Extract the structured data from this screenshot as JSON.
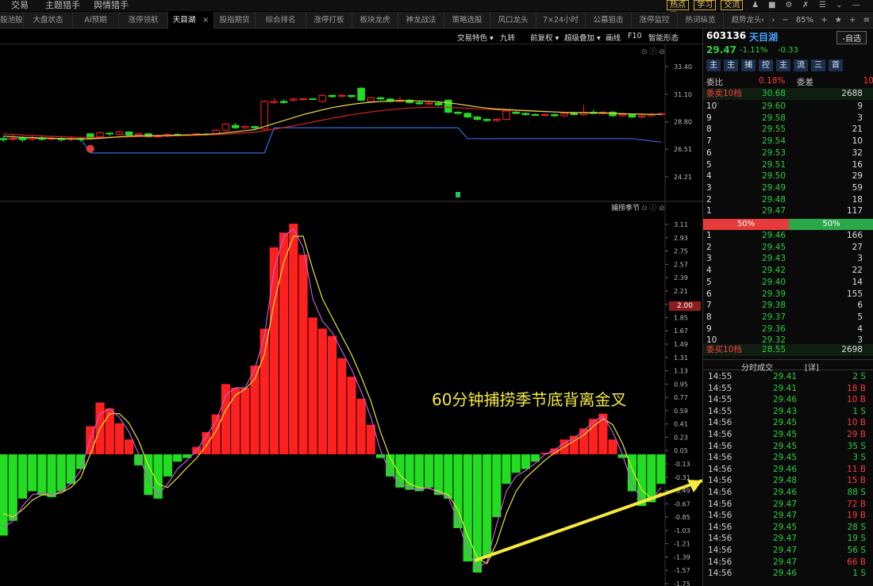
{
  "topbar": {
    "menu": [
      "交易",
      "主题猎手",
      "舆情猎手"
    ],
    "buttons": [
      "热点",
      "学习",
      "交流"
    ]
  },
  "tabs": {
    "items": [
      "股池股",
      "大盘状态",
      "AI预期",
      "涨停领航",
      "天目湖",
      "股指期货",
      "综合排名",
      "涨停打板",
      "板块龙虎",
      "神龙战法",
      "策略选股",
      "风口龙头",
      "7×24小时",
      "公募狙击",
      "涨停监控",
      "热词纵览",
      "趋势龙头"
    ],
    "active_index": 4,
    "close_glyph": "×",
    "zoom": "85%"
  },
  "toolbar": {
    "items": [
      "交易特色 ▾",
      "九转",
      "前复权 ▾",
      "超级叠加 ▾",
      "画线",
      "F10",
      "智能形态"
    ]
  },
  "price_axis": {
    "ticks": [
      "33.40",
      "31.10",
      "28.80",
      "26.51",
      "24.21"
    ]
  },
  "indicator": {
    "name": "捕捞季节",
    "marker_value": "2.00",
    "ticks": [
      "3.11",
      "2.93",
      "2.75",
      "2.57",
      "2.39",
      "2.21",
      "2.03",
      "1.85",
      "1.67",
      "1.49",
      "1.31",
      "1.13",
      "0.95",
      "0.77",
      "0.59",
      "0.41",
      "0.23",
      "0.05",
      "-0.13",
      "-0.31",
      "-0.49",
      "-0.67",
      "-0.85",
      "-1.03",
      "-1.21",
      "-1.39",
      "-1.57",
      "-1.75"
    ]
  },
  "annotation": "60分钟捕捞季节底背离金叉",
  "colors": {
    "up": "#ff2020",
    "down": "#22dd22",
    "annotation": "#f6ea3b"
  },
  "quote": {
    "code": "603136",
    "name": "天目湖",
    "self_select": "-自选",
    "price": "29.47",
    "change_pct": "-1.11%",
    "change": "-0.33",
    "quick_buttons": [
      "主",
      "主",
      "捕",
      "控",
      "主",
      "流",
      "三",
      "首"
    ],
    "ratio_label": "委比",
    "ratio_value": "0.18%",
    "diff_label": "委差",
    "diff_value": "10",
    "sell10_label": "委卖10档",
    "sell10_price": "30.68",
    "sell10_vol": "2688",
    "asks": [
      {
        "lvl": "10",
        "price": "29.60",
        "vol": "9"
      },
      {
        "lvl": "9",
        "price": "29.58",
        "vol": "3"
      },
      {
        "lvl": "8",
        "price": "29.55",
        "vol": "21"
      },
      {
        "lvl": "7",
        "price": "29.54",
        "vol": "10"
      },
      {
        "lvl": "6",
        "price": "29.53",
        "vol": "32"
      },
      {
        "lvl": "5",
        "price": "29.51",
        "vol": "16"
      },
      {
        "lvl": "4",
        "price": "29.50",
        "vol": "29"
      },
      {
        "lvl": "3",
        "price": "29.49",
        "vol": "59"
      },
      {
        "lvl": "2",
        "price": "29.48",
        "vol": "18"
      },
      {
        "lvl": "1",
        "price": "29.47",
        "vol": "117"
      }
    ],
    "split_left": "50%",
    "split_right": "50%",
    "bids": [
      {
        "lvl": "1",
        "price": "29.46",
        "vol": "166"
      },
      {
        "lvl": "2",
        "price": "29.45",
        "vol": "27"
      },
      {
        "lvl": "3",
        "price": "29.43",
        "vol": "3"
      },
      {
        "lvl": "4",
        "price": "29.42",
        "vol": "22"
      },
      {
        "lvl": "5",
        "price": "29.40",
        "vol": "14"
      },
      {
        "lvl": "6",
        "price": "29.39",
        "vol": "155"
      },
      {
        "lvl": "7",
        "price": "29.38",
        "vol": "6"
      },
      {
        "lvl": "8",
        "price": "29.37",
        "vol": "5"
      },
      {
        "lvl": "9",
        "price": "29.36",
        "vol": "4"
      },
      {
        "lvl": "10",
        "price": "29.32",
        "vol": "3"
      }
    ],
    "buy10_label": "委买10档",
    "buy10_price": "28.55",
    "buy10_vol": "2698",
    "trades_title": "分时成交",
    "trades_detail": "[详]",
    "trades": [
      {
        "t": "14:55",
        "p": "29.41",
        "v": "2 S",
        "side": "S"
      },
      {
        "t": "14:55",
        "p": "29.41",
        "v": "18 B",
        "side": "B"
      },
      {
        "t": "14:55",
        "p": "29.46",
        "v": "10 B",
        "side": "B"
      },
      {
        "t": "14:55",
        "p": "29.43",
        "v": "1 S",
        "side": "S"
      },
      {
        "t": "14:56",
        "p": "29.45",
        "v": "10 B",
        "side": "B"
      },
      {
        "t": "14:56",
        "p": "29.45",
        "v": "29 B",
        "side": "B"
      },
      {
        "t": "14:56",
        "p": "29.45",
        "v": "35 S",
        "side": "S"
      },
      {
        "t": "14:56",
        "p": "29.45",
        "v": "3 S",
        "side": "S"
      },
      {
        "t": "14:56",
        "p": "29.46",
        "v": "11 B",
        "side": "B"
      },
      {
        "t": "14:56",
        "p": "29.48",
        "v": "15 B",
        "side": "B"
      },
      {
        "t": "14:56",
        "p": "29.46",
        "v": "88 S",
        "side": "S"
      },
      {
        "t": "14:56",
        "p": "29.47",
        "v": "72 B",
        "side": "B"
      },
      {
        "t": "14:56",
        "p": "29.47",
        "v": "19 B",
        "side": "B"
      },
      {
        "t": "14:56",
        "p": "29.45",
        "v": "28 S",
        "side": "S"
      },
      {
        "t": "14:56",
        "p": "29.47",
        "v": "19 S",
        "side": "S"
      },
      {
        "t": "14:56",
        "p": "29.47",
        "v": "56 S",
        "side": "S"
      },
      {
        "t": "14:56",
        "p": "29.47",
        "v": "66 B",
        "side": "B"
      },
      {
        "t": "14:56",
        "p": "29.46",
        "v": "1 S",
        "side": "S"
      }
    ]
  },
  "candles": [
    {
      "o": 27.4,
      "c": 27.3,
      "h": 27.6,
      "l": 27.1
    },
    {
      "o": 27.35,
      "c": 27.4,
      "h": 27.7,
      "l": 27.2
    },
    {
      "o": 27.45,
      "c": 27.3,
      "h": 27.6,
      "l": 27.1
    },
    {
      "o": 27.35,
      "c": 27.45,
      "h": 27.7,
      "l": 27.2
    },
    {
      "o": 27.4,
      "c": 27.35,
      "h": 27.6,
      "l": 27.2
    },
    {
      "o": 27.4,
      "c": 27.42,
      "h": 27.6,
      "l": 27.2
    },
    {
      "o": 27.4,
      "c": 27.3,
      "h": 27.55,
      "l": 27.1
    },
    {
      "o": 27.35,
      "c": 27.4,
      "h": 27.6,
      "l": 27.2
    },
    {
      "o": 27.4,
      "c": 27.32,
      "h": 27.55,
      "l": 27.15
    },
    {
      "o": 27.8,
      "c": 27.4,
      "h": 27.85,
      "l": 27.3
    },
    {
      "o": 27.55,
      "c": 27.9,
      "h": 28.0,
      "l": 27.5
    },
    {
      "o": 27.85,
      "c": 27.8,
      "h": 27.95,
      "l": 27.6
    },
    {
      "o": 27.75,
      "c": 27.95,
      "h": 28.05,
      "l": 27.7
    },
    {
      "o": 27.95,
      "c": 27.7,
      "h": 28.0,
      "l": 27.6
    },
    {
      "o": 27.7,
      "c": 27.8,
      "h": 27.9,
      "l": 27.55
    },
    {
      "o": 27.8,
      "c": 27.55,
      "h": 27.85,
      "l": 27.45
    },
    {
      "o": 27.55,
      "c": 27.6,
      "h": 27.75,
      "l": 27.45
    },
    {
      "o": 27.6,
      "c": 27.75,
      "h": 27.85,
      "l": 27.5
    },
    {
      "o": 27.75,
      "c": 27.7,
      "h": 27.85,
      "l": 27.6
    },
    {
      "o": 27.7,
      "c": 27.72,
      "h": 27.8,
      "l": 27.6
    },
    {
      "o": 27.7,
      "c": 27.8,
      "h": 27.85,
      "l": 27.6
    },
    {
      "o": 27.78,
      "c": 27.74,
      "h": 27.85,
      "l": 27.65
    },
    {
      "o": 27.75,
      "c": 28.1,
      "h": 28.2,
      "l": 27.7
    },
    {
      "o": 28.1,
      "c": 28.6,
      "h": 28.7,
      "l": 28.0
    },
    {
      "o": 28.5,
      "c": 28.3,
      "h": 28.7,
      "l": 28.2
    },
    {
      "o": 28.3,
      "c": 28.4,
      "h": 28.5,
      "l": 28.2
    },
    {
      "o": 28.4,
      "c": 28.3,
      "h": 28.5,
      "l": 28.2
    },
    {
      "o": 28.2,
      "c": 30.5,
      "h": 30.6,
      "l": 28.1
    },
    {
      "o": 30.4,
      "c": 30.5,
      "h": 30.8,
      "l": 30.3
    },
    {
      "o": 30.5,
      "c": 30.4,
      "h": 30.7,
      "l": 30.3
    },
    {
      "o": 30.6,
      "c": 30.7,
      "h": 30.8,
      "l": 30.5
    },
    {
      "o": 30.7,
      "c": 30.72,
      "h": 30.75,
      "l": 30.65
    },
    {
      "o": 30.72,
      "c": 30.7,
      "h": 30.76,
      "l": 30.65
    },
    {
      "o": 30.5,
      "c": 31.0,
      "h": 31.1,
      "l": 30.4
    },
    {
      "o": 31.0,
      "c": 30.9,
      "h": 31.05,
      "l": 30.8
    },
    {
      "o": 30.95,
      "c": 31.0,
      "h": 31.1,
      "l": 30.85
    },
    {
      "o": 31.0,
      "c": 30.9,
      "h": 31.05,
      "l": 30.8
    },
    {
      "o": 31.6,
      "c": 30.6,
      "h": 31.7,
      "l": 30.5
    },
    {
      "o": 30.5,
      "c": 30.8,
      "h": 30.9,
      "l": 30.4
    },
    {
      "o": 30.8,
      "c": 30.7,
      "h": 30.9,
      "l": 30.6
    },
    {
      "o": 30.7,
      "c": 30.5,
      "h": 30.8,
      "l": 30.4
    },
    {
      "o": 30.5,
      "c": 30.6,
      "h": 30.9,
      "l": 30.45
    },
    {
      "o": 30.6,
      "c": 30.4,
      "h": 30.7,
      "l": 30.3
    },
    {
      "o": 30.4,
      "c": 30.3,
      "h": 30.5,
      "l": 30.2
    },
    {
      "o": 30.3,
      "c": 30.35,
      "h": 30.45,
      "l": 30.2
    },
    {
      "o": 30.35,
      "c": 30.2,
      "h": 30.45,
      "l": 30.1
    },
    {
      "o": 30.6,
      "c": 29.6,
      "h": 30.7,
      "l": 29.5
    },
    {
      "o": 29.6,
      "c": 29.5,
      "h": 29.7,
      "l": 29.4
    },
    {
      "o": 29.5,
      "c": 29.2,
      "h": 29.6,
      "l": 29.1
    },
    {
      "o": 29.2,
      "c": 29.0,
      "h": 29.3,
      "l": 28.9
    },
    {
      "o": 29.0,
      "c": 28.9,
      "h": 29.1,
      "l": 28.8
    },
    {
      "o": 28.9,
      "c": 29.0,
      "h": 29.1,
      "l": 28.8
    },
    {
      "o": 29.0,
      "c": 29.7,
      "h": 29.8,
      "l": 28.9
    },
    {
      "o": 29.6,
      "c": 29.5,
      "h": 29.7,
      "l": 29.4
    },
    {
      "o": 29.5,
      "c": 29.4,
      "h": 29.6,
      "l": 29.3
    },
    {
      "o": 29.4,
      "c": 29.35,
      "h": 29.5,
      "l": 29.3
    },
    {
      "o": 29.35,
      "c": 29.4,
      "h": 29.5,
      "l": 29.3
    },
    {
      "o": 29.4,
      "c": 29.3,
      "h": 29.5,
      "l": 29.2
    },
    {
      "o": 29.3,
      "c": 29.5,
      "h": 29.6,
      "l": 29.2
    },
    {
      "o": 29.5,
      "c": 29.4,
      "h": 29.65,
      "l": 29.3
    },
    {
      "o": 29.4,
      "c": 29.6,
      "h": 30.2,
      "l": 29.3
    },
    {
      "o": 29.6,
      "c": 29.5,
      "h": 29.8,
      "l": 29.4
    },
    {
      "o": 29.5,
      "c": 29.6,
      "h": 29.7,
      "l": 29.4
    },
    {
      "o": 29.6,
      "c": 29.3,
      "h": 29.7,
      "l": 29.2
    },
    {
      "o": 29.3,
      "c": 29.4,
      "h": 29.5,
      "l": 29.2
    },
    {
      "o": 29.4,
      "c": 29.2,
      "h": 29.5,
      "l": 29.1
    },
    {
      "o": 29.2,
      "c": 29.3,
      "h": 29.4,
      "l": 29.1
    },
    {
      "o": 29.3,
      "c": 29.4,
      "h": 29.55,
      "l": 29.2
    },
    {
      "o": 29.4,
      "c": 29.47,
      "h": 29.6,
      "l": 29.3
    }
  ],
  "ma1": [
    27.6,
    27.55,
    27.5,
    27.48,
    27.45,
    27.43,
    27.4,
    27.38,
    27.37,
    27.38,
    27.42,
    27.48,
    27.55,
    27.6,
    27.63,
    27.64,
    27.65,
    27.66,
    27.68,
    27.7,
    27.73,
    27.75,
    27.8,
    27.88,
    27.97,
    28.06,
    28.15,
    28.4,
    28.65,
    28.9,
    29.15,
    29.4,
    29.6,
    29.8,
    29.98,
    30.12,
    30.25,
    30.35,
    30.43,
    30.49,
    30.53,
    30.56,
    30.56,
    30.54,
    30.51,
    30.46,
    30.38,
    30.28,
    30.16,
    30.04,
    29.94,
    29.86,
    29.82,
    29.78,
    29.74,
    29.7,
    29.66,
    29.62,
    29.58,
    29.56,
    29.55,
    29.54,
    29.53,
    29.5,
    29.48,
    29.45,
    29.43,
    29.42,
    29.42
  ],
  "ma2": [
    27.8,
    27.75,
    27.7,
    27.66,
    27.62,
    27.58,
    27.55,
    27.52,
    27.5,
    27.49,
    27.49,
    27.5,
    27.52,
    27.54,
    27.56,
    27.58,
    27.6,
    27.62,
    27.64,
    27.66,
    27.68,
    27.7,
    27.73,
    27.77,
    27.82,
    27.88,
    27.94,
    28.05,
    28.18,
    28.32,
    28.47,
    28.62,
    28.78,
    28.94,
    29.09,
    29.24,
    29.38,
    29.51,
    29.62,
    29.72,
    29.81,
    29.88,
    29.94,
    29.98,
    30.0,
    30.01,
    30.0,
    29.97,
    29.93,
    29.88,
    29.84,
    29.8,
    29.77,
    29.74,
    29.71,
    29.68,
    29.65,
    29.62,
    29.59,
    29.57,
    29.55,
    29.53,
    29.51,
    29.49,
    29.47,
    29.45,
    29.43,
    29.42,
    29.41
  ],
  "support": [
    27.4,
    27.4,
    27.4,
    27.4,
    27.4,
    27.4,
    27.4,
    27.4,
    27.4,
    26.2,
    26.2,
    26.2,
    26.2,
    26.2,
    26.2,
    26.2,
    26.2,
    26.2,
    26.2,
    26.2,
    26.2,
    26.2,
    26.2,
    26.2,
    26.2,
    26.2,
    26.2,
    26.2,
    28.3,
    28.3,
    28.3,
    28.3,
    28.3,
    28.3,
    28.3,
    28.3,
    28.3,
    28.3,
    28.3,
    28.3,
    28.3,
    28.3,
    28.3,
    28.3,
    28.3,
    28.3,
    28.3,
    28.3,
    27.4,
    27.4,
    27.4,
    27.4,
    27.4,
    27.4,
    27.4,
    27.4,
    27.4,
    27.4,
    27.4,
    27.4,
    27.4,
    27.4,
    27.4,
    27.4,
    27.4,
    27.4,
    27.3,
    27.2,
    27.1
  ],
  "hist": [
    -1.1,
    -0.9,
    -0.6,
    -0.5,
    -0.55,
    -0.58,
    -0.5,
    -0.4,
    -0.2,
    0.38,
    0.7,
    0.62,
    0.42,
    0.2,
    -0.15,
    -0.55,
    -0.6,
    -0.3,
    -0.1,
    -0.05,
    0.1,
    0.3,
    0.54,
    0.95,
    0.9,
    0.9,
    1.2,
    1.7,
    2.8,
    3.0,
    3.12,
    2.7,
    1.85,
    1.7,
    1.6,
    1.3,
    1.05,
    0.75,
    0.4,
    -0.05,
    -0.3,
    -0.45,
    -0.48,
    -0.5,
    -0.45,
    -0.55,
    -0.6,
    -1.0,
    -1.45,
    -1.6,
    -1.4,
    -0.85,
    -0.4,
    -0.25,
    -0.2,
    -0.1,
    0.02,
    0.08,
    0.2,
    0.25,
    0.35,
    0.48,
    0.55,
    0.2,
    -0.05,
    -0.5,
    -0.7,
    -0.65,
    -0.4
  ],
  "line1": [
    -1.0,
    -0.9,
    -0.7,
    -0.55,
    -0.52,
    -0.55,
    -0.5,
    -0.4,
    -0.22,
    0.2,
    0.55,
    0.62,
    0.5,
    0.3,
    0.0,
    -0.35,
    -0.55,
    -0.4,
    -0.2,
    -0.08,
    0.05,
    0.25,
    0.45,
    0.8,
    0.9,
    0.9,
    1.15,
    1.6,
    2.5,
    2.95,
    3.05,
    2.8,
    2.1,
    1.8,
    1.65,
    1.4,
    1.15,
    0.85,
    0.5,
    0.05,
    -0.25,
    -0.4,
    -0.45,
    -0.48,
    -0.45,
    -0.52,
    -0.58,
    -0.9,
    -1.3,
    -1.55,
    -1.45,
    -0.95,
    -0.5,
    -0.3,
    -0.22,
    -0.12,
    0.0,
    0.06,
    0.15,
    0.22,
    0.32,
    0.44,
    0.52,
    0.3,
    0.0,
    -0.4,
    -0.62,
    -0.62,
    -0.45
  ],
  "line2": [
    -0.8,
    -0.85,
    -0.75,
    -0.62,
    -0.55,
    -0.55,
    -0.52,
    -0.45,
    -0.32,
    0.0,
    0.35,
    0.55,
    0.55,
    0.42,
    0.18,
    -0.15,
    -0.4,
    -0.45,
    -0.32,
    -0.18,
    -0.05,
    0.12,
    0.32,
    0.6,
    0.8,
    0.88,
    1.02,
    1.35,
    2.05,
    2.6,
    2.95,
    2.95,
    2.5,
    2.1,
    1.85,
    1.6,
    1.35,
    1.05,
    0.72,
    0.3,
    -0.05,
    -0.28,
    -0.4,
    -0.45,
    -0.46,
    -0.5,
    -0.55,
    -0.75,
    -1.1,
    -1.4,
    -1.48,
    -1.2,
    -0.8,
    -0.5,
    -0.32,
    -0.2,
    -0.08,
    0.02,
    0.1,
    0.18,
    0.26,
    0.38,
    0.48,
    0.4,
    0.15,
    -0.2,
    -0.48,
    -0.6,
    -0.52
  ]
}
